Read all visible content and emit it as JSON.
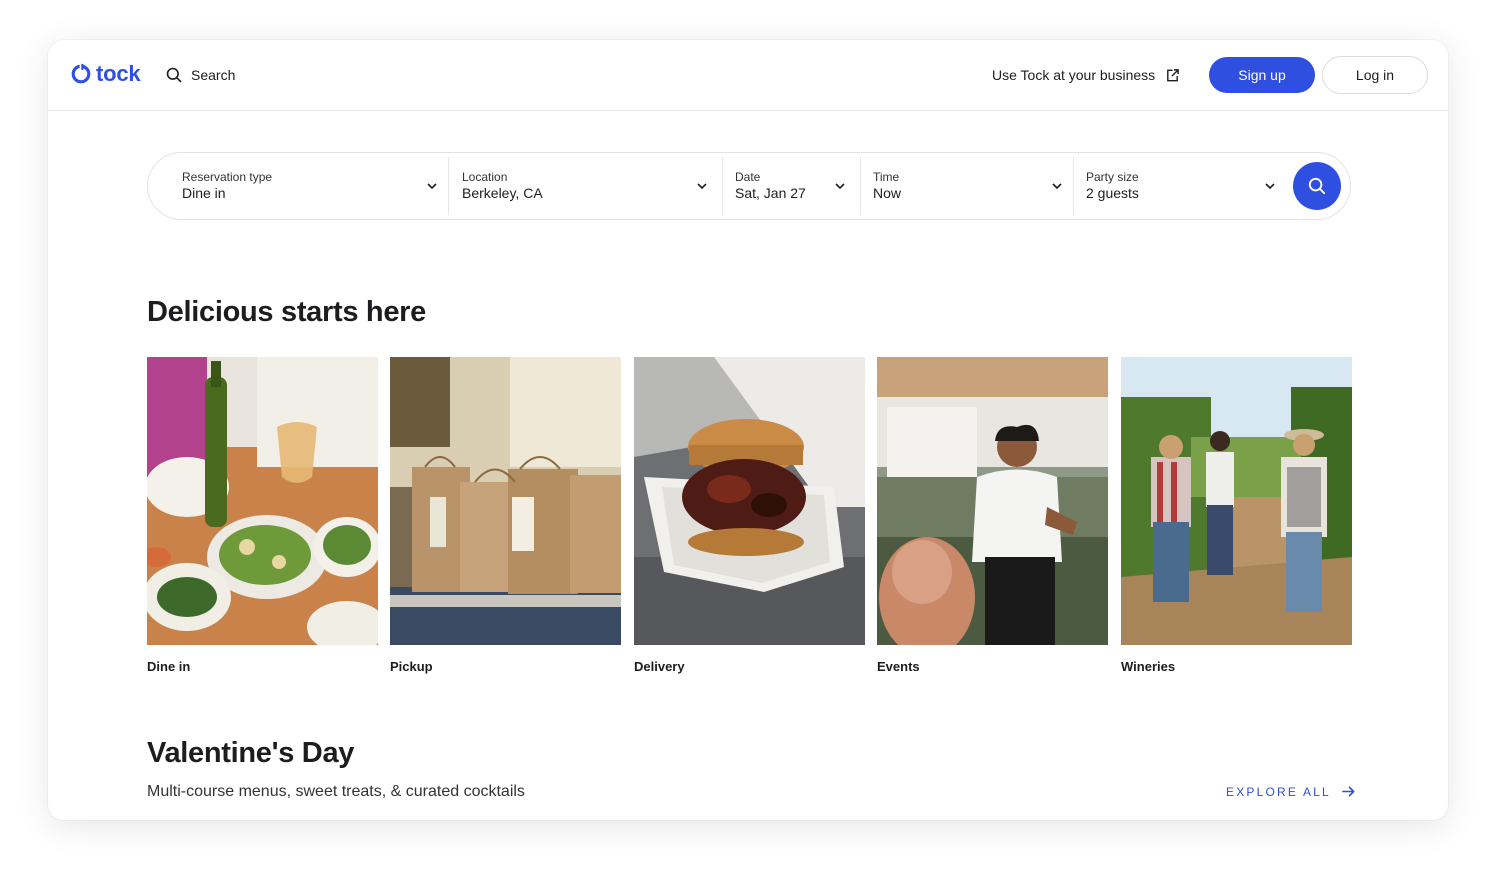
{
  "brand": {
    "name": "tock",
    "color": "#2f4fe0"
  },
  "header": {
    "search_label": "Search",
    "business_link": "Use Tock at your business",
    "signup_label": "Sign up",
    "login_label": "Log in"
  },
  "search_bar": {
    "fields": [
      {
        "label": "Reservation type",
        "value": "Dine in"
      },
      {
        "label": "Location",
        "value": "Berkeley, CA"
      },
      {
        "label": "Date",
        "value": "Sat, Jan 27"
      },
      {
        "label": "Time",
        "value": "Now"
      },
      {
        "label": "Party size",
        "value": "2 guests"
      }
    ]
  },
  "categories_section": {
    "title": "Delicious starts here",
    "items": [
      {
        "label": "Dine in"
      },
      {
        "label": "Pickup"
      },
      {
        "label": "Delivery"
      },
      {
        "label": "Events"
      },
      {
        "label": "Wineries"
      }
    ]
  },
  "valentines_section": {
    "title": "Valentine's Day",
    "subtitle": "Multi-course menus, sweet treats, & curated cocktails",
    "explore_label": "EXPLORE ALL"
  }
}
